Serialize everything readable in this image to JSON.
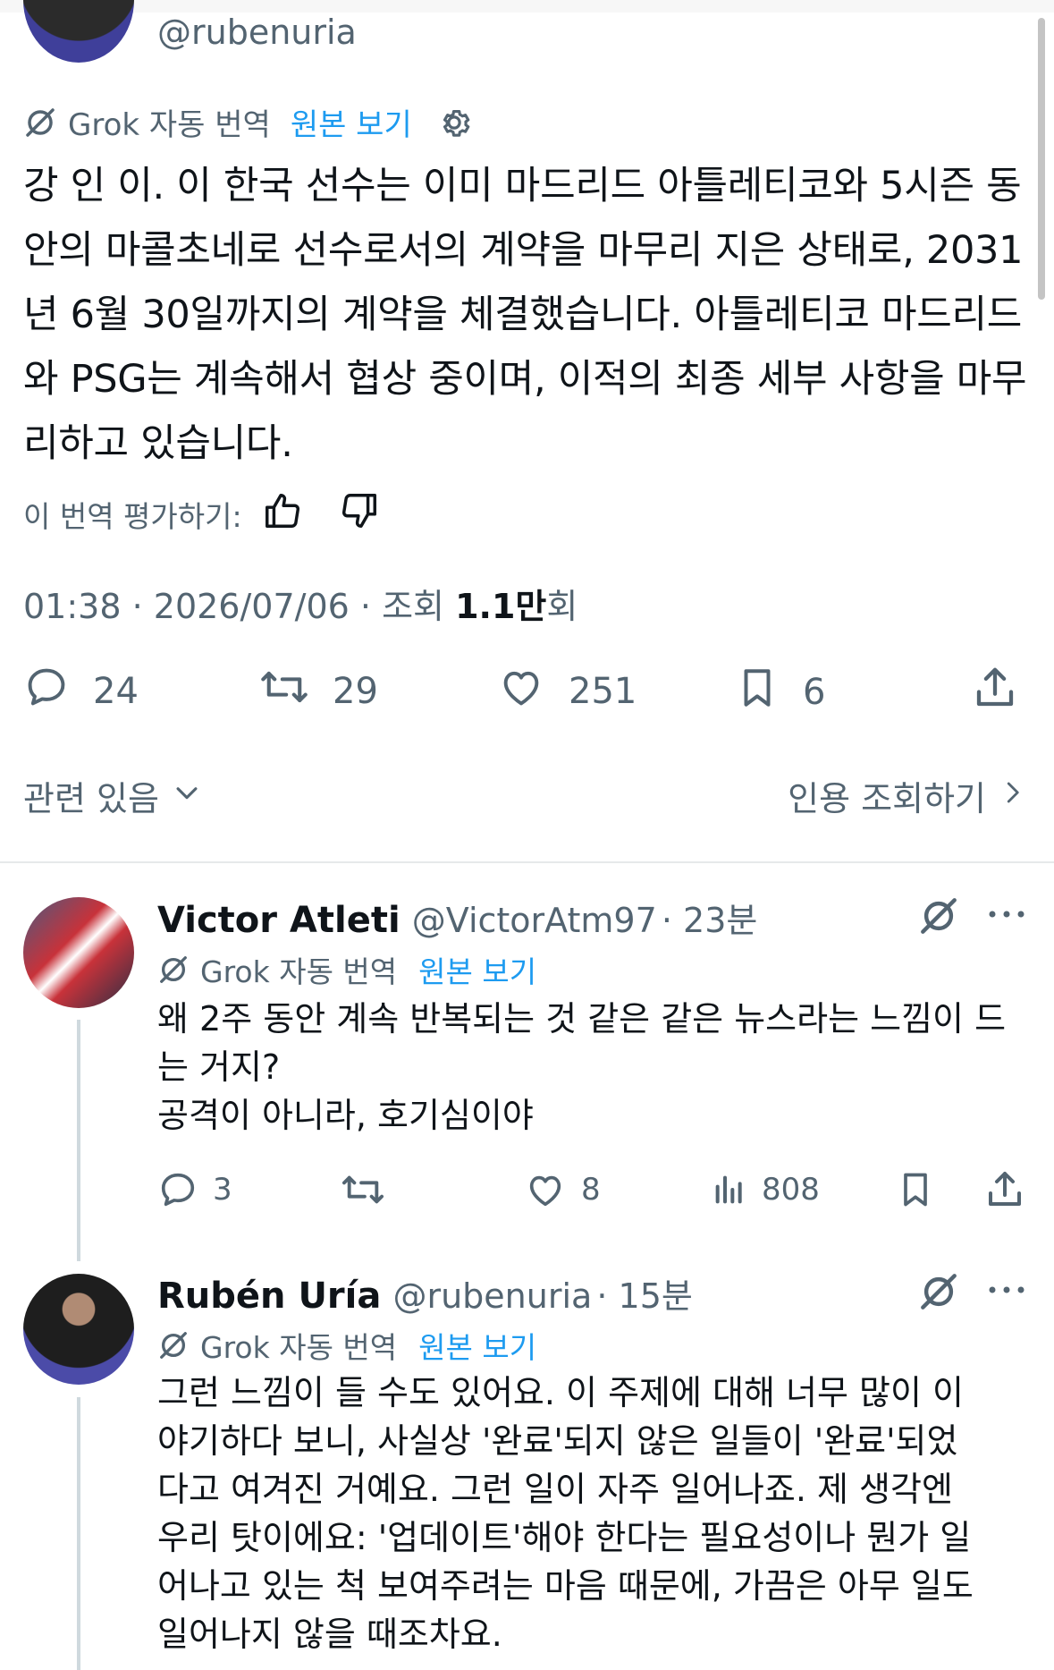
{
  "original_tweet": {
    "handle": "@rubenuria",
    "grok_label": "Grok 자동 번역",
    "view_original": "원본 보기",
    "text": "강 인 이. 이 한국 선수는 이미 마드리드 아틀레티코와 5시즌 동안의 마콜초네로 선수로서의 계약을 마무리 지은 상태로, 2031년 6월 30일까지의 계약을 체결했습니다. 아틀레티코 마드리드와 PSG는 계속해서 협상 중이며, 이적의 최종 세부 사항을 마무리하고 있습니다.",
    "rate_label": "이 번역 평가하기:",
    "time": "01:38",
    "date": "2026/07/06",
    "views_label": "조회",
    "views_value": "1.1만",
    "views_suffix": "회",
    "replies": "24",
    "reposts": "29",
    "likes": "251",
    "bookmarks": "6",
    "related_label": "관련 있음",
    "quotes_label": "인용 조회하기"
  },
  "replies": [
    {
      "name": "Victor Atleti",
      "handle": "@VictorAtm97",
      "time": "· 23분",
      "grok_label": "Grok 자동 번역",
      "view_original": "원본 보기",
      "text_lines": [
        "왜 2주 동안 계속 반복되는 것 같은 같은 뉴스라는 느낌이 드",
        "는 거지?",
        "공격이 아니라, 호기심이야"
      ],
      "replies": "3",
      "reposts": "",
      "likes": "8",
      "views": "808"
    },
    {
      "name": "Rubén Uría",
      "handle": "@rubenuria",
      "time": "· 15분",
      "grok_label": "Grok 자동 번역",
      "view_original": "원본 보기",
      "text_lines": [
        "그런 느낌이 들 수도 있어요. 이 주제에 대해 너무 많이 이",
        "야기하다 보니, 사실상 '완료'되지 않은 일들이 '완료'되었",
        "다고 여겨진 거예요. 그런 일이 자주 일어나죠. 제 생각엔",
        "우리 탓이에요: '업데이트'해야 한다는 필요성이나 뭔가 일",
        "어나고 있는 척 보여주려는 마음 때문에, 가끔은 아무 일도",
        "일어나지 않을 때조차요."
      ]
    }
  ],
  "colors": {
    "text": "#0f1419",
    "secondary": "#536471",
    "accent": "#1d9bf0",
    "divider": "#e6e9ea"
  }
}
